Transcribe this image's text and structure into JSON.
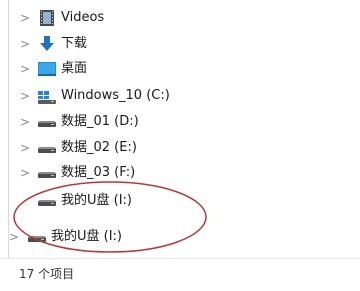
{
  "nav": {
    "items": [
      {
        "label": "Videos",
        "icon": "video-folder-icon"
      },
      {
        "label": "下载",
        "icon": "download-folder-icon"
      },
      {
        "label": "桌面",
        "icon": "desktop-folder-icon"
      },
      {
        "label": "Windows_10 (C:)",
        "icon": "windows-drive-icon"
      },
      {
        "label": "数据_01 (D:)",
        "icon": "drive-icon"
      },
      {
        "label": "数据_02 (E:)",
        "icon": "drive-icon"
      },
      {
        "label": "数据_03 (F:)",
        "icon": "drive-icon"
      },
      {
        "label": "我的U盘 (I:)",
        "icon": "usb-drive-icon"
      },
      {
        "label": "我的U盘 (I:)",
        "icon": "usb-drive-icon"
      }
    ]
  },
  "status": {
    "item_count": "17 个项目"
  },
  "colors": {
    "annotation_ellipse": "#b03a3a",
    "accent": "#1e73be"
  }
}
